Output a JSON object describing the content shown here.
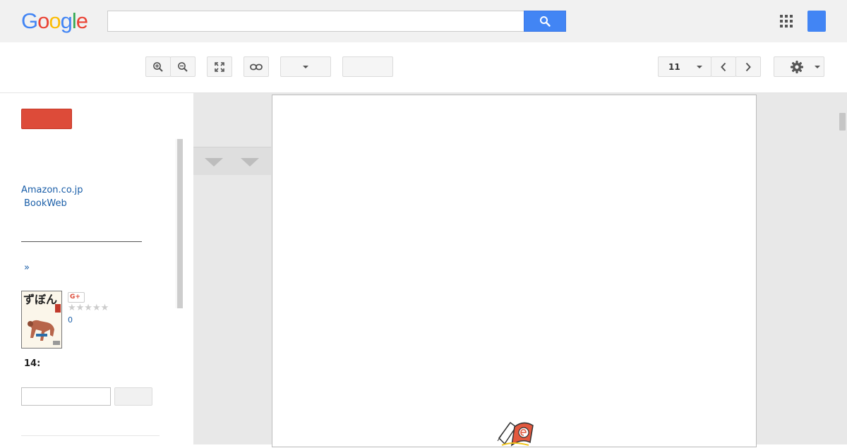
{
  "header": {
    "logo": [
      "G",
      "o",
      "o",
      "g",
      "l",
      "e"
    ],
    "search": {
      "value": "",
      "placeholder": ""
    }
  },
  "toolbar": {
    "page_number": "11"
  },
  "sidebar": {
    "links": [
      "Amazon.co.jp",
      "BookWeb"
    ],
    "more_link": "»",
    "gplus_label": "G+",
    "stars": "★★★★★",
    "review_count": "0",
    "section_heading": "14:"
  },
  "colors": {
    "brand_blue": "#4285f4",
    "get_book_red": "#dd4b39",
    "link_blue": "#1a5ea8"
  }
}
